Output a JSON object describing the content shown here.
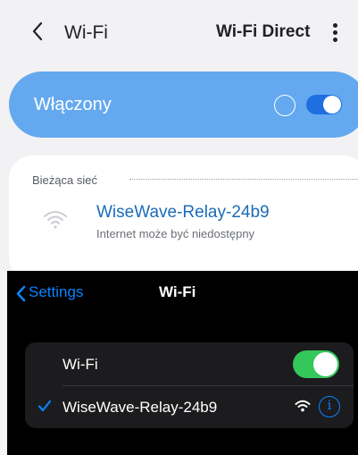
{
  "android": {
    "header": {
      "title": "Wi-Fi",
      "direct_label": "Wi-Fi Direct",
      "back_icon": "chevron-left-icon",
      "more_icon": "more-vertical-icon"
    },
    "master_switch": {
      "label": "Włączony",
      "state": "on",
      "card_color": "#64a9ef",
      "toggle_color": "#1f6fe0"
    },
    "current_network": {
      "section_label": "Bieżąca sieć",
      "ssid": "WiseWave-Relay-24b9",
      "status": "Internet może być niedostępny",
      "ssid_color": "#1a6cb8",
      "icon": "wifi-icon"
    }
  },
  "ios": {
    "nav": {
      "back_label": "Settings",
      "title": "Wi-Fi",
      "accent": "#0a84ff"
    },
    "wifi_row": {
      "label": "Wi-Fi",
      "state": "on",
      "toggle_color": "#34c759"
    },
    "network_row": {
      "ssid": "WiseWave-Relay-24b9",
      "connected": true,
      "info_glyph": "i",
      "icons": [
        "checkmark-icon",
        "wifi-icon",
        "info-icon"
      ]
    }
  }
}
